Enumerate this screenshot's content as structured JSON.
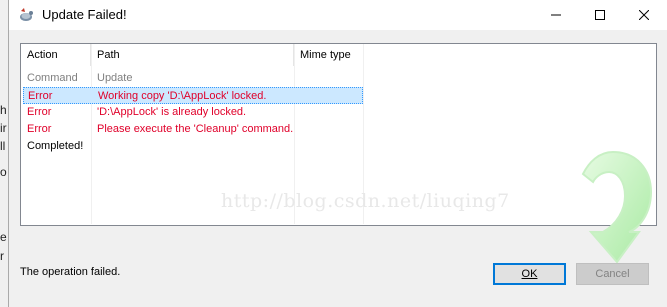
{
  "background_window": {
    "fragments": [
      "h",
      "ir",
      "ll",
      "o",
      "e",
      "r"
    ]
  },
  "dialog": {
    "title": "Update Failed!",
    "icon": "tortoise-svn-icon"
  },
  "titlebar_controls": [
    "minimize-icon",
    "maximize-icon",
    "close-icon"
  ],
  "list": {
    "columns": [
      "Action",
      "Path",
      "Mime type"
    ],
    "rows": [
      {
        "action": "Command",
        "path": "Update",
        "color": "#808080",
        "selected": false
      },
      {
        "action": "Error",
        "path": "Working copy 'D:\\AppLock' locked.",
        "color": "#e0002a",
        "selected": true
      },
      {
        "action": "Error",
        "path": "'D:\\AppLock' is already locked.",
        "color": "#e0002a",
        "selected": false
      },
      {
        "action": "Error",
        "path": "Please execute the 'Cleanup' command.",
        "color": "#e0002a",
        "selected": false
      },
      {
        "action": "Completed!",
        "path": "",
        "color": "#000000",
        "selected": false
      }
    ]
  },
  "watermark": "http://blog.csdn.net/liuqing7",
  "status_text": "The operation failed.",
  "buttons": {
    "ok": "OK",
    "cancel": "Cancel"
  },
  "colors": {
    "error": "#e0002a",
    "arrow": "#b7f0b2",
    "accent": "#0078d7"
  }
}
